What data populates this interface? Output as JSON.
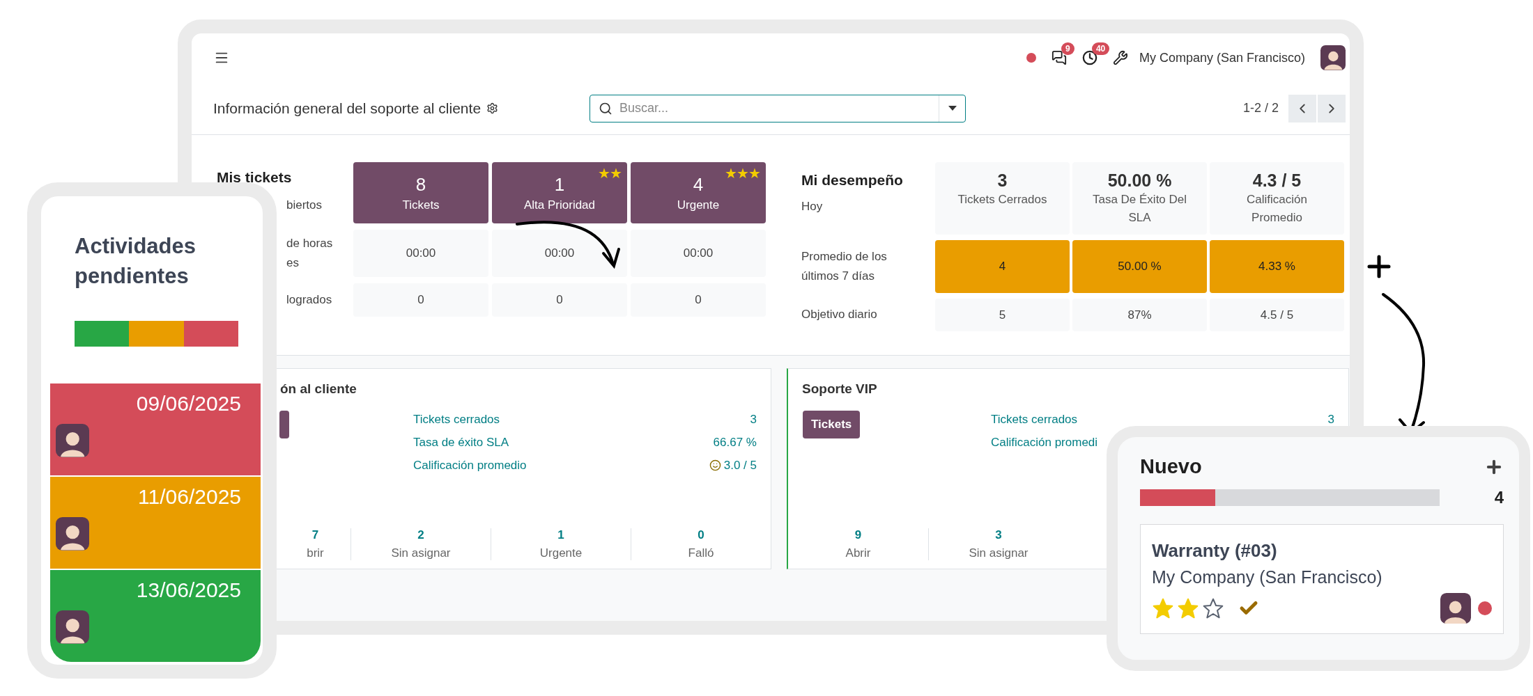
{
  "topbar": {
    "busy": true,
    "messages_badge": "9",
    "activities_badge": "40",
    "company": "My Company (San Francisco)"
  },
  "control_panel": {
    "title": "Información general del soporte al cliente",
    "search": {
      "placeholder": "Buscar..."
    },
    "pager": "1-2 / 2"
  },
  "my_tickets": {
    "title": "Mis tickets",
    "subtitle": "biertos",
    "tiles": [
      {
        "value": "8",
        "label": "Tickets"
      },
      {
        "value": "1",
        "label": "Alta Prioridad",
        "priority": "★★"
      },
      {
        "value": "4",
        "label": "Urgente",
        "priority": "★★★"
      }
    ],
    "rows": [
      {
        "label_lines": [
          "de horas",
          "es"
        ],
        "values": [
          "00:00",
          "00:00",
          "00:00"
        ]
      },
      {
        "label_lines": [
          "logrados"
        ],
        "values": [
          "0",
          "0",
          "0"
        ]
      }
    ]
  },
  "performance": {
    "title": "Mi desempeño",
    "subtitle": "Hoy",
    "tiles": [
      {
        "value": "3",
        "label": "Tickets Cerrados"
      },
      {
        "value": "50.00 %",
        "label": "Tasa De Éxito Del SLA"
      },
      {
        "value": "4.3 / 5",
        "label": "Calificación Promedio"
      }
    ],
    "rows": [
      {
        "label": "Promedio de los últimos 7 días",
        "highlighted": true,
        "values": [
          "4",
          "50.00 %",
          "4.33 %"
        ]
      },
      {
        "label": "Objetivo diario",
        "highlighted": false,
        "values": [
          "5",
          "87%",
          "4.5 / 5"
        ]
      }
    ]
  },
  "teams": [
    {
      "title": "ón al cliente",
      "button": {
        "kind": "sliver"
      },
      "metrics": [
        {
          "label": "Tickets cerrados",
          "value": "3",
          "kind": "plain"
        },
        {
          "label": "Tasa de éxito SLA",
          "value": "66.67 %",
          "kind": "plain"
        },
        {
          "label": "Calificación promedio",
          "value": "3.0 / 5",
          "kind": "rating"
        }
      ],
      "stats": [
        {
          "value": "7",
          "label": "brir"
        },
        {
          "value": "2",
          "label": "Sin asignar"
        },
        {
          "value": "1",
          "label": "Urgente"
        },
        {
          "value": "0",
          "label": "Falló"
        }
      ]
    },
    {
      "title": "Soporte VIP",
      "highlighted": true,
      "button": {
        "kind": "full",
        "label": "Tickets"
      },
      "metrics": [
        {
          "label": "Tickets cerrados",
          "value": "3",
          "kind": "plain"
        },
        {
          "label": "Calificación promedi",
          "kind": "plain"
        }
      ],
      "stats": [
        {
          "value": "9",
          "label": "Abrir"
        },
        {
          "value": "3",
          "label": "Sin asignar"
        }
      ]
    }
  ],
  "activities": {
    "title": "Actividades pendientes",
    "segments": [
      {
        "color": "#28a745"
      },
      {
        "color": "#e99d00"
      },
      {
        "color": "#d44c59"
      }
    ],
    "items": [
      {
        "date": "09/06/2025",
        "color": "#d44c59"
      },
      {
        "date": "11/06/2025",
        "color": "#e99d00"
      },
      {
        "date": "13/06/2025",
        "color": "#28a745"
      }
    ]
  },
  "kanban": {
    "column": "Nuevo",
    "count": "4",
    "progress": {
      "level": 0.25,
      "color": "#d44c59"
    },
    "record": {
      "title": "Warranty (#03)",
      "company": "My Company (San Francisco)",
      "stars": 2,
      "done": true,
      "blocked": true
    }
  }
}
